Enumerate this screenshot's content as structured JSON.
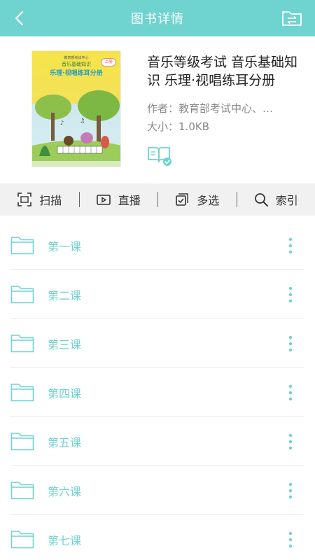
{
  "header": {
    "title": "图书详情",
    "back_icon": "chevron-left-icon",
    "action_icon": "folder-swap-icon"
  },
  "book": {
    "title": "音乐等级考试 音乐基础知识 乐理·视唱练耳分册",
    "author_label": "作者：",
    "author": "教育部考试中心、…",
    "size_label": "大小：",
    "size": "1.0KB",
    "cover": {
      "top_line": "教育部考试中心",
      "series": "音乐基础知识",
      "subtitle": "乐理·视唱练耳分册",
      "volume": "上册"
    }
  },
  "toolbar": [
    {
      "label": "扫描",
      "icon": "scan-icon"
    },
    {
      "label": "直播",
      "icon": "live-camera-icon"
    },
    {
      "label": "多选",
      "icon": "multi-select-icon"
    },
    {
      "label": "索引",
      "icon": "search-icon"
    }
  ],
  "lessons": [
    "第一课",
    "第二课",
    "第三课",
    "第四课",
    "第五课",
    "第六课",
    "第七课"
  ],
  "colors": {
    "accent": "#6fd3d0",
    "text": "#222222",
    "muted": "#888888",
    "toolbar_bg": "#f1f1f1"
  }
}
